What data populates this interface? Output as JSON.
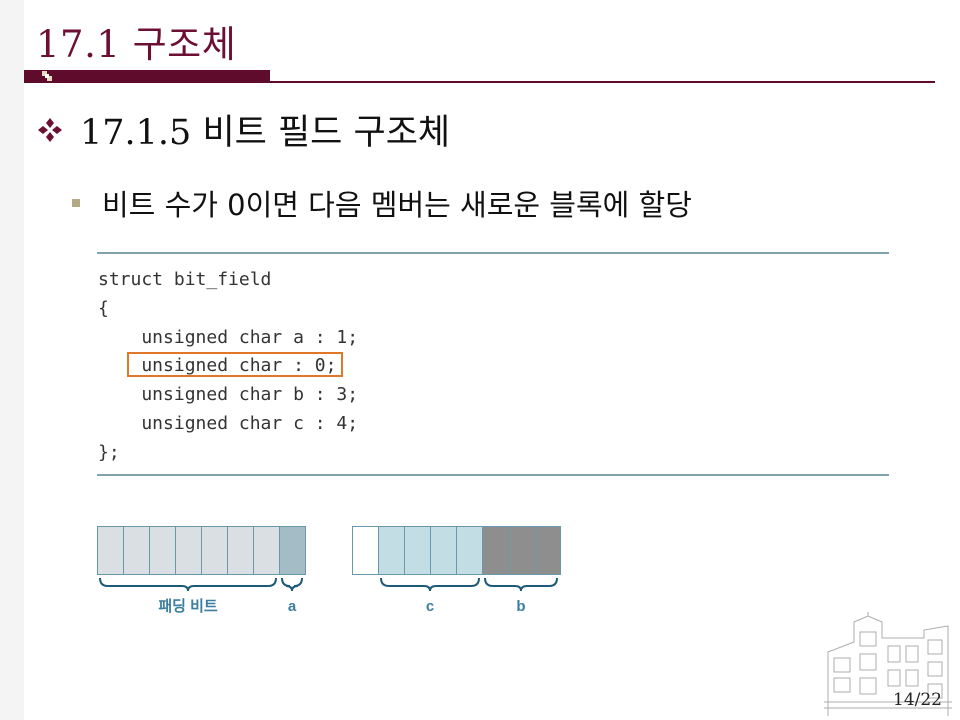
{
  "slide": {
    "title": "17.1 구조체",
    "heading": "17.1.5 비트 필드 구조체",
    "bullet": "비트 수가 0이면 다음 멤버는 새로운 블록에 할당",
    "page_number": "14/22"
  },
  "code": {
    "lines": [
      "struct bit_field",
      "{",
      "    unsigned char a : 1;",
      "    unsigned char : 0;",
      "    unsigned char b : 3;",
      "    unsigned char c : 4;",
      "};"
    ],
    "highlighted_line": 3,
    "highlight_color": "#e0782a"
  },
  "diagram": {
    "block1": {
      "cells": [
        "padding",
        "padding",
        "padding",
        "padding",
        "padding",
        "padding",
        "padding",
        "a"
      ],
      "labels": [
        {
          "text": "패딩 비트",
          "from": 0,
          "to": 7
        },
        {
          "text": "a",
          "from": 7,
          "to": 8
        }
      ]
    },
    "block2": {
      "cells": [
        "empty",
        "c",
        "c",
        "c",
        "c",
        "b",
        "b",
        "b"
      ],
      "labels": [
        {
          "text": "c",
          "from": 1,
          "to": 5
        },
        {
          "text": "b",
          "from": 5,
          "to": 8
        }
      ]
    },
    "colors": {
      "padding": "#d9dfe3",
      "a": "#a3bcc6",
      "c": "#c3dde5",
      "b": "#8e8e8e",
      "empty": "#ffffff",
      "cell_border": "#6a98ab",
      "brace": "#1d5a78",
      "label": "#3b7ea0"
    }
  },
  "theme": {
    "title_color": "#6d0f33",
    "title_bar_color": "#5e0b2c",
    "rule_color": "#7ea3ae",
    "bullet_color": "#b2a886"
  },
  "icons": [
    "diamond-bullet-icon",
    "square-bullet-icon",
    "checker-icon",
    "campus-building-icon"
  ]
}
